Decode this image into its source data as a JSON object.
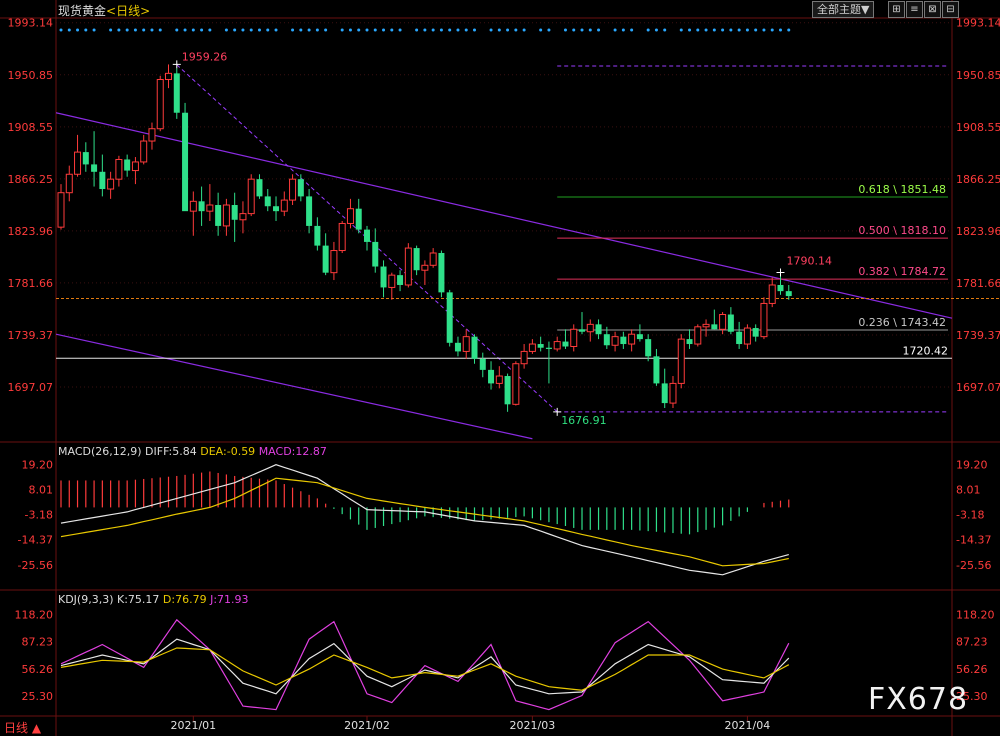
{
  "header": {
    "symbol": "现货黄金",
    "period_open": "<",
    "period": "日线",
    "period_close": ">",
    "theme_button": "全部主题",
    "theme_arrow": "▼",
    "tools": [
      "⊞",
      "≡",
      "⊠",
      "⊟"
    ]
  },
  "footer": {
    "period_label": "日线 ▲"
  },
  "watermark": "FX678",
  "colors": {
    "background": "#000000",
    "up": "#ff3b3b",
    "down": "#2fe08a",
    "grid": "#3a1010",
    "axis_text": "#ff3b3b",
    "trendline": "#8a2be2",
    "dash_purple": "#9a3cff",
    "fib_green": "#1fa01f",
    "fib_red": "#e0305a",
    "fib_gray": "#9a9a9a",
    "white_line": "#e6e6e6",
    "orange_line": "#e07a10"
  },
  "chart_data": [
    {
      "type": "candlestick",
      "y_ticks": [
        1993.14,
        1950.85,
        1908.55,
        1866.25,
        1823.96,
        1781.66,
        1739.37,
        1697.07
      ],
      "ylim": [
        1654,
        1997
      ],
      "x_ticks": [
        "2021/01",
        "2021/02",
        "2021/03",
        "2021/04"
      ],
      "annotations": {
        "high": "1959.26",
        "low": "1676.91",
        "recent_high": "1790.14",
        "support": "1720.42"
      },
      "fib_levels": [
        {
          "label": "0.618 \\ 1851.48",
          "value": 1851.48
        },
        {
          "label": "0.500 \\ 1818.10",
          "value": 1818.1
        },
        {
          "label": "0.382 \\ 1784.72",
          "value": 1784.72
        },
        {
          "label": "0.236 \\ 1743.42",
          "value": 1743.42
        }
      ],
      "current_price": 1769,
      "candles": [
        [
          1827,
          1862,
          1825,
          1855
        ],
        [
          1855,
          1877,
          1848,
          1870
        ],
        [
          1870,
          1902,
          1868,
          1888
        ],
        [
          1888,
          1896,
          1872,
          1878
        ],
        [
          1878,
          1905,
          1860,
          1872
        ],
        [
          1872,
          1886,
          1852,
          1858
        ],
        [
          1858,
          1872,
          1850,
          1866
        ],
        [
          1866,
          1885,
          1860,
          1882
        ],
        [
          1882,
          1886,
          1868,
          1873
        ],
        [
          1873,
          1884,
          1862,
          1880
        ],
        [
          1880,
          1902,
          1878,
          1897
        ],
        [
          1897,
          1912,
          1890,
          1907
        ],
        [
          1907,
          1950,
          1905,
          1947
        ],
        [
          1947,
          1959.26,
          1940,
          1952
        ],
        [
          1952,
          1956,
          1915,
          1920
        ],
        [
          1920,
          1928,
          1858,
          1840
        ],
        [
          1840,
          1856,
          1820,
          1848
        ],
        [
          1848,
          1860,
          1828,
          1840
        ],
        [
          1840,
          1862,
          1832,
          1845
        ],
        [
          1845,
          1855,
          1820,
          1828
        ],
        [
          1828,
          1850,
          1820,
          1845
        ],
        [
          1845,
          1855,
          1815,
          1833
        ],
        [
          1833,
          1848,
          1822,
          1838
        ],
        [
          1838,
          1870,
          1836,
          1866
        ],
        [
          1866,
          1870,
          1850,
          1852
        ],
        [
          1852,
          1858,
          1840,
          1844
        ],
        [
          1844,
          1852,
          1832,
          1840
        ],
        [
          1840,
          1856,
          1836,
          1849
        ],
        [
          1849,
          1870,
          1845,
          1866
        ],
        [
          1866,
          1870,
          1848,
          1852
        ],
        [
          1852,
          1858,
          1822,
          1828
        ],
        [
          1828,
          1835,
          1808,
          1812
        ],
        [
          1812,
          1822,
          1788,
          1790
        ],
        [
          1790,
          1815,
          1784,
          1808
        ],
        [
          1808,
          1832,
          1806,
          1830
        ],
        [
          1830,
          1850,
          1826,
          1842
        ],
        [
          1842,
          1850,
          1822,
          1825
        ],
        [
          1825,
          1828,
          1808,
          1815
        ],
        [
          1815,
          1826,
          1790,
          1795
        ],
        [
          1795,
          1800,
          1770,
          1778
        ],
        [
          1778,
          1790,
          1768,
          1788
        ],
        [
          1788,
          1792,
          1775,
          1780
        ],
        [
          1780,
          1814,
          1778,
          1810
        ],
        [
          1810,
          1812,
          1788,
          1792
        ],
        [
          1792,
          1800,
          1780,
          1796
        ],
        [
          1796,
          1810,
          1794,
          1806
        ],
        [
          1806,
          1808,
          1770,
          1774
        ],
        [
          1774,
          1776,
          1730,
          1733
        ],
        [
          1733,
          1738,
          1722,
          1726
        ],
        [
          1726,
          1744,
          1720,
          1738
        ],
        [
          1738,
          1740,
          1716,
          1720
        ],
        [
          1720,
          1725,
          1705,
          1711
        ],
        [
          1711,
          1718,
          1695,
          1700
        ],
        [
          1700,
          1714,
          1696,
          1706
        ],
        [
          1706,
          1708,
          1676.91,
          1683
        ],
        [
          1683,
          1718,
          1682,
          1716
        ],
        [
          1716,
          1732,
          1712,
          1726
        ],
        [
          1726,
          1736,
          1724,
          1732
        ],
        [
          1732,
          1738,
          1726,
          1729
        ],
        [
          1729,
          1734,
          1700,
          1728
        ],
        [
          1728,
          1738,
          1726,
          1734
        ],
        [
          1734,
          1744,
          1728,
          1730
        ],
        [
          1730,
          1748,
          1726,
          1744
        ],
        [
          1744,
          1758,
          1740,
          1742
        ],
        [
          1742,
          1752,
          1734,
          1748
        ],
        [
          1748,
          1752,
          1736,
          1740
        ],
        [
          1740,
          1746,
          1728,
          1731
        ],
        [
          1731,
          1742,
          1726,
          1738
        ],
        [
          1738,
          1742,
          1728,
          1732
        ],
        [
          1732,
          1744,
          1726,
          1740
        ],
        [
          1740,
          1748,
          1734,
          1736
        ],
        [
          1736,
          1740,
          1718,
          1722
        ],
        [
          1722,
          1728,
          1698,
          1700
        ],
        [
          1700,
          1712,
          1680,
          1684
        ],
        [
          1684,
          1706,
          1680,
          1700
        ],
        [
          1700,
          1740,
          1696,
          1736
        ],
        [
          1736,
          1744,
          1728,
          1732
        ],
        [
          1732,
          1748,
          1730,
          1746
        ],
        [
          1746,
          1752,
          1738,
          1748
        ],
        [
          1748,
          1760,
          1744,
          1744
        ],
        [
          1744,
          1758,
          1740,
          1756
        ],
        [
          1756,
          1762,
          1740,
          1742
        ],
        [
          1742,
          1750,
          1728,
          1732
        ],
        [
          1732,
          1748,
          1728,
          1745
        ],
        [
          1745,
          1748,
          1734,
          1738
        ],
        [
          1738,
          1770,
          1736,
          1765
        ],
        [
          1765,
          1786,
          1762,
          1780
        ],
        [
          1780,
          1790.14,
          1772,
          1775
        ],
        [
          1775,
          1780,
          1768,
          1771
        ]
      ]
    },
    {
      "type": "bar",
      "title": "MACD(26,12,9)",
      "labels": {
        "diff": "DIFF:5.84",
        "dea": "DEA:-0.59",
        "macd": "MACD:12.87"
      },
      "y_ticks": [
        19.2,
        8.01,
        -3.18,
        -14.37,
        -25.56
      ],
      "ylim": [
        -35,
        22
      ],
      "diff_key": [
        [
          0,
          -7
        ],
        [
          8,
          -2
        ],
        [
          14,
          4
        ],
        [
          18,
          8
        ],
        [
          21,
          11
        ],
        [
          26,
          19
        ],
        [
          31,
          13
        ],
        [
          37,
          -1
        ],
        [
          44,
          -2
        ],
        [
          50,
          -6
        ],
        [
          56,
          -8
        ],
        [
          63,
          -17
        ],
        [
          69,
          -22
        ],
        [
          76,
          -28
        ],
        [
          80,
          -30
        ],
        [
          85,
          -24
        ],
        [
          89,
          -20
        ],
        [
          94,
          -16
        ],
        [
          98,
          -13
        ],
        [
          102,
          -8
        ],
        [
          106,
          -4
        ],
        [
          110,
          -2
        ],
        [
          114,
          2
        ],
        [
          118,
          5
        ]
      ],
      "dea_key": [
        [
          0,
          -13
        ],
        [
          8,
          -8
        ],
        [
          14,
          -3
        ],
        [
          18,
          0
        ],
        [
          21,
          4
        ],
        [
          26,
          13
        ],
        [
          31,
          11
        ],
        [
          37,
          4
        ],
        [
          44,
          0
        ],
        [
          50,
          -3
        ],
        [
          56,
          -6
        ],
        [
          63,
          -12
        ],
        [
          69,
          -17
        ],
        [
          76,
          -22
        ],
        [
          80,
          -26
        ],
        [
          85,
          -25
        ],
        [
          89,
          -22
        ],
        [
          94,
          -20
        ],
        [
          98,
          -17
        ],
        [
          102,
          -12
        ],
        [
          106,
          -8
        ],
        [
          110,
          -4
        ],
        [
          114,
          -2
        ],
        [
          118,
          1
        ]
      ]
    },
    {
      "type": "line",
      "title": "KDJ(9,3,3)",
      "labels": {
        "k": "K:75.17",
        "d": "D:76.79",
        "j": "J:71.93"
      },
      "y_ticks": [
        118.2,
        87.23,
        56.26,
        25.3
      ],
      "ylim": [
        5,
        130
      ],
      "k_key": [
        [
          0,
          60
        ],
        [
          5,
          72
        ],
        [
          10,
          62
        ],
        [
          14,
          90
        ],
        [
          18,
          78
        ],
        [
          22,
          40
        ],
        [
          26,
          28
        ],
        [
          30,
          68
        ],
        [
          33,
          85
        ],
        [
          37,
          48
        ],
        [
          40,
          36
        ],
        [
          44,
          55
        ],
        [
          48,
          46
        ],
        [
          52,
          70
        ],
        [
          55,
          38
        ],
        [
          59,
          28
        ],
        [
          63,
          30
        ],
        [
          67,
          62
        ],
        [
          71,
          84
        ],
        [
          76,
          70
        ],
        [
          80,
          44
        ],
        [
          85,
          40
        ],
        [
          89,
          78
        ],
        [
          94,
          92
        ],
        [
          98,
          86
        ],
        [
          101,
          50
        ],
        [
          105,
          92
        ],
        [
          110,
          85
        ],
        [
          114,
          78
        ],
        [
          118,
          75
        ]
      ],
      "d_key": [
        [
          0,
          58
        ],
        [
          5,
          66
        ],
        [
          10,
          64
        ],
        [
          14,
          80
        ],
        [
          18,
          78
        ],
        [
          22,
          54
        ],
        [
          26,
          38
        ],
        [
          30,
          56
        ],
        [
          33,
          72
        ],
        [
          37,
          58
        ],
        [
          40,
          46
        ],
        [
          44,
          52
        ],
        [
          48,
          48
        ],
        [
          52,
          62
        ],
        [
          55,
          48
        ],
        [
          59,
          36
        ],
        [
          63,
          32
        ],
        [
          67,
          50
        ],
        [
          71,
          72
        ],
        [
          76,
          72
        ],
        [
          80,
          56
        ],
        [
          85,
          46
        ],
        [
          89,
          66
        ],
        [
          94,
          82
        ],
        [
          98,
          84
        ],
        [
          101,
          64
        ],
        [
          105,
          80
        ],
        [
          110,
          82
        ],
        [
          114,
          80
        ],
        [
          118,
          77
        ]
      ],
      "j_key": [
        [
          0,
          62
        ],
        [
          5,
          84
        ],
        [
          10,
          58
        ],
        [
          14,
          112
        ],
        [
          18,
          78
        ],
        [
          22,
          14
        ],
        [
          26,
          10
        ],
        [
          30,
          90
        ],
        [
          33,
          110
        ],
        [
          37,
          28
        ],
        [
          40,
          18
        ],
        [
          44,
          60
        ],
        [
          48,
          42
        ],
        [
          52,
          84
        ],
        [
          55,
          20
        ],
        [
          59,
          10
        ],
        [
          63,
          26
        ],
        [
          67,
          86
        ],
        [
          71,
          110
        ],
        [
          76,
          66
        ],
        [
          80,
          20
        ],
        [
          85,
          30
        ],
        [
          89,
          104
        ],
        [
          94,
          114
        ],
        [
          98,
          92
        ],
        [
          101,
          24
        ],
        [
          105,
          114
        ],
        [
          110,
          90
        ],
        [
          114,
          74
        ],
        [
          118,
          72
        ]
      ]
    }
  ]
}
